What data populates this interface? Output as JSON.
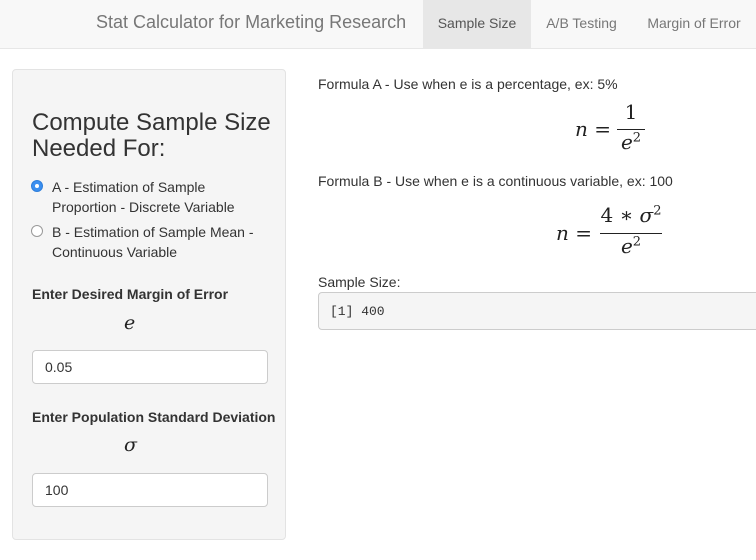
{
  "navbar": {
    "brand": "Stat Calculator for Marketing Research",
    "tabs": [
      {
        "label": "Sample Size",
        "active": true
      },
      {
        "label": "A/B Testing",
        "active": false
      },
      {
        "label": "Margin of Error",
        "active": false
      }
    ]
  },
  "sidebar": {
    "title": "Compute Sample Size Needed For:",
    "options": [
      {
        "label": "A - Estimation of Sample Proportion - Discrete Variable",
        "checked": true
      },
      {
        "label": "B - Estimation of Sample Mean - Continuous Variable",
        "checked": false
      }
    ],
    "margin_error": {
      "label": "Enter Desired Margin of Error",
      "symbol": "e",
      "value": "0.05"
    },
    "std_dev": {
      "label": "Enter Population Standard Deviation",
      "symbol": "σ",
      "value": "100"
    }
  },
  "main": {
    "formula_a": {
      "label": "Formula A - Use when e is a percentage, ex: 5%",
      "lhs": "n =",
      "numerator": "1",
      "denominator_base": "e",
      "denominator_exp": "2"
    },
    "formula_b": {
      "label": "Formula B - Use when e is a continuous variable, ex: 100",
      "lhs": "n =",
      "numerator_coef": "4 ∗ ",
      "numerator_base": "σ",
      "numerator_exp": "2",
      "denominator_base": "e",
      "denominator_exp": "2"
    },
    "output": {
      "label": "Sample Size:",
      "value": "[1] 400"
    }
  },
  "colors": {
    "radio_accent": "#3b8ff0",
    "navbar_bg": "#f8f8f8",
    "sidebar_bg": "#f5f5f5"
  }
}
